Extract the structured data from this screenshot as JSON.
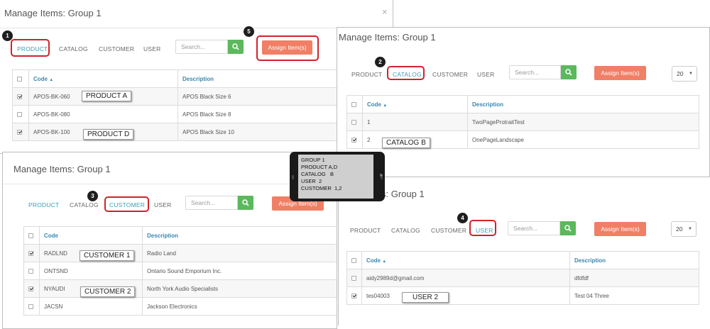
{
  "panel1": {
    "title": "Manage Items: Group 1",
    "close": "×",
    "tabs": [
      "PRODUCT",
      "CATALOG",
      "CUSTOMER",
      "USER"
    ],
    "search_placeholder": "Search...",
    "assign": "Assign Item(s)",
    "columns": [
      "Code",
      "Description"
    ],
    "rows": [
      {
        "checked": true,
        "code": "APOS-BK-060",
        "desc": "APOS Black Size 6"
      },
      {
        "checked": false,
        "code": "APOS-BK-080",
        "desc": "APOS Black Size 8"
      },
      {
        "checked": true,
        "code": "APOS-BK-100",
        "desc": "APOS Black Size 10"
      }
    ],
    "callouts": [
      "PRODUCT A",
      "PRODUCT D"
    ]
  },
  "panel2": {
    "title": "Manage Items: Group 1",
    "tabs": [
      "PRODUCT",
      "CATALOG",
      "CUSTOMER",
      "USER"
    ],
    "search_placeholder": "Search...",
    "assign": "Assign Item(s)",
    "page_size": "20",
    "columns": [
      "Code",
      "Description"
    ],
    "rows": [
      {
        "checked": false,
        "code": "1",
        "desc": "TwoPageProtraitTest"
      },
      {
        "checked": true,
        "code": "2",
        "desc": "OnePageLandscape"
      }
    ],
    "callouts": [
      "CATALOG B"
    ]
  },
  "panel3": {
    "title": "Manage Items: Group 1",
    "tabs": [
      "PRODUCT",
      "CATALOG",
      "CUSTOMER",
      "USER"
    ],
    "search_placeholder": "Search...",
    "assign": "Assign Item(s)",
    "columns": [
      "Code",
      "Description"
    ],
    "rows": [
      {
        "checked": true,
        "code": "RADLND",
        "desc": "Radio Land"
      },
      {
        "checked": false,
        "code": "ONTSND",
        "desc": "Ontario Sound Emporium Inc."
      },
      {
        "checked": true,
        "code": "NYAUDI",
        "desc": "North York Audio Specialists"
      },
      {
        "checked": false,
        "code": "JACSN",
        "desc": "Jackson Electronics"
      }
    ],
    "callouts": [
      "CUSTOMER 1",
      "CUSTOMER 2"
    ]
  },
  "panel4": {
    "title": "s: Group 1",
    "tabs": [
      "PRODUCT",
      "CATALOG",
      "CUSTOMER",
      "USER"
    ],
    "search_placeholder": "Search...",
    "assign": "Assign Item(s)",
    "page_size": "20",
    "columns": [
      "Code",
      "Description"
    ],
    "rows": [
      {
        "checked": false,
        "code": "aidy2989d@gmail.com",
        "desc": "dfdfdf"
      },
      {
        "checked": true,
        "code": "tes04003",
        "desc": "Test 04 Three"
      }
    ],
    "callouts": [
      "USER 2"
    ]
  },
  "badges": [
    "1",
    "2",
    "3",
    "4",
    "5"
  ],
  "summary": {
    "lines": [
      "GROUP 1",
      "PRODUCT A,D",
      "CATALOG   B",
      "USER  2",
      "CUSTOMER  1,2"
    ],
    "arrow": "»"
  },
  "colors": {
    "accent": "#3a9fb8",
    "assign": "#f07f66",
    "search": "#5cb85c",
    "highlight": "#d0232a"
  },
  "icons": {
    "search": "search-icon",
    "sort": "sort-ascending-icon"
  }
}
